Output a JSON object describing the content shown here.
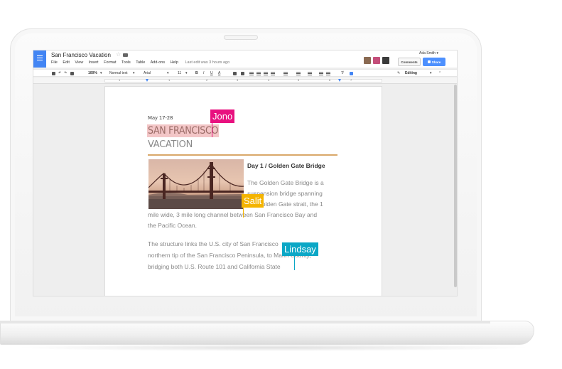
{
  "app": {
    "title": "San Francisco Vacation",
    "menu": [
      "File",
      "Edit",
      "View",
      "Insert",
      "Format",
      "Tools",
      "Table",
      "Add-ons",
      "Help"
    ],
    "last_edit": "Last edit was 3 hours ago",
    "user_name": "Ada Smith ▾",
    "comments_label": "Comments",
    "share_label": "Share"
  },
  "toolbar": {
    "zoom": "100%",
    "style": "Normal text",
    "font": "Arial",
    "size": "11",
    "bold": "B",
    "italic": "I",
    "underline": "U",
    "text_color": "A",
    "mode": "Editing"
  },
  "ruler": {
    "numbers": [
      "1",
      "1",
      "2",
      "3",
      "4",
      "5",
      "6",
      "7"
    ]
  },
  "document": {
    "date": "May 17-28",
    "title_line1": "SAN FRANCISCO",
    "title_line2": "VACATION",
    "day_heading": "Day 1 / Golden Gate Bridge",
    "para1_lines": [
      "The Golden Gate Bridge is a",
      "suspension bridge spanning",
      "the Golden Gate strait, the 1",
      "mile wide, 3 mile long channel between San Francisco Bay and",
      "the Pacific Ocean."
    ],
    "para2_lines": [
      "The structure links the U.S. city of San Francisco",
      "northern tip of the San Francisco Peninsula, to Marin County,",
      "bridging both U.S. Route 101 and California State"
    ]
  },
  "collaborators": [
    {
      "name": "Jono",
      "color": "#e8117f"
    },
    {
      "name": "Salit",
      "color": "#f4b400"
    },
    {
      "name": "Lindsay",
      "color": "#0ba7c6"
    }
  ],
  "colors": {
    "docs_blue": "#4285f4",
    "share_blue": "#4d90fe",
    "title_highlight": "#f3c6c7",
    "rule": "#d9a86a"
  }
}
